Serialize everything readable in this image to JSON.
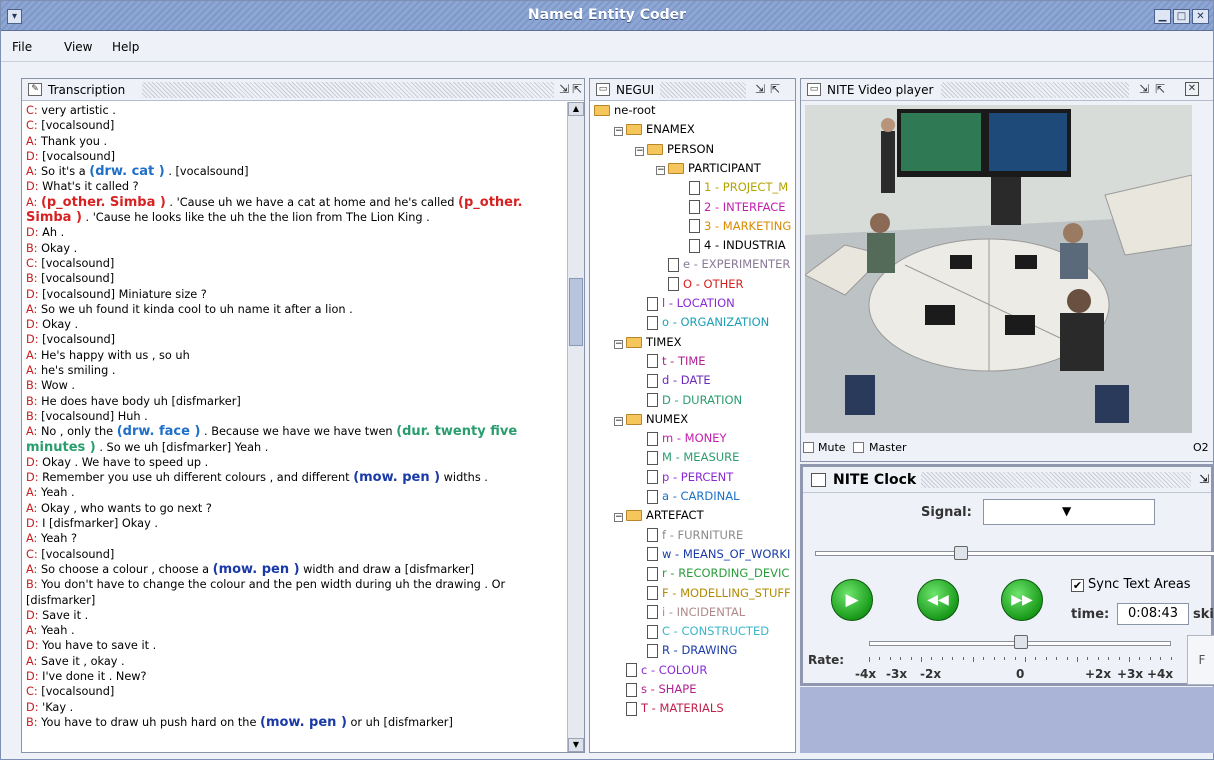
{
  "window": {
    "title": "Named Entity Coder"
  },
  "menu": [
    "File",
    "View",
    "Help"
  ],
  "transcription": {
    "title": "Transcription",
    "lines": [
      {
        "parts": [
          {
            "t": "C: ",
            "c": "#c41e1e"
          },
          {
            "t": "very artistic .",
            "c": "#000"
          }
        ]
      },
      {
        "parts": [
          {
            "t": "C: ",
            "c": "#c41e1e"
          },
          {
            "t": "[vocalsound]",
            "c": "#000"
          }
        ]
      },
      {
        "parts": [
          {
            "t": "A: ",
            "c": "#c41e1e"
          },
          {
            "t": "Thank you .",
            "c": "#000"
          }
        ]
      },
      {
        "parts": [
          {
            "t": "D: ",
            "c": "#c41e1e"
          },
          {
            "t": "[vocalsound]",
            "c": "#000"
          }
        ]
      },
      {
        "parts": [
          {
            "t": "A: ",
            "c": "#c41e1e"
          },
          {
            "t": "So it's a ",
            "c": "#000"
          },
          {
            "t": "(drw. cat )",
            "c": "#1f6fc7",
            "tag": true
          },
          {
            "t": " . [vocalsound]",
            "c": "#000"
          }
        ]
      },
      {
        "parts": [
          {
            "t": "D: ",
            "c": "#c41e1e"
          },
          {
            "t": "What's it called ?",
            "c": "#000"
          }
        ]
      },
      {
        "parts": [
          {
            "t": "A: ",
            "c": "#c41e1e"
          },
          {
            "t": "(p_other. Simba )",
            "c": "#d62222",
            "tag": true
          },
          {
            "t": " . 'Cause uh we have a cat at home and he's called ",
            "c": "#000"
          },
          {
            "t": "(p_other.",
            "c": "#d62222",
            "tag": true
          }
        ]
      },
      {
        "parts": [
          {
            "t": "Simba )",
            "c": "#d62222",
            "tag": true
          },
          {
            "t": " . 'Cause he looks like the uh the the lion from The Lion King .",
            "c": "#000"
          }
        ]
      },
      {
        "parts": [
          {
            "t": "D: ",
            "c": "#c41e1e"
          },
          {
            "t": "Ah .",
            "c": "#000"
          }
        ]
      },
      {
        "parts": [
          {
            "t": "B: ",
            "c": "#c41e1e"
          },
          {
            "t": "Okay .",
            "c": "#000"
          }
        ]
      },
      {
        "parts": [
          {
            "t": "C: ",
            "c": "#c41e1e"
          },
          {
            "t": "[vocalsound]",
            "c": "#000"
          }
        ]
      },
      {
        "parts": [
          {
            "t": "B: ",
            "c": "#c41e1e"
          },
          {
            "t": "[vocalsound]",
            "c": "#000"
          }
        ]
      },
      {
        "parts": [
          {
            "t": "D: ",
            "c": "#c41e1e"
          },
          {
            "t": "[vocalsound] Miniature size ?",
            "c": "#000"
          }
        ]
      },
      {
        "parts": [
          {
            "t": "A: ",
            "c": "#c41e1e"
          },
          {
            "t": "So we uh found it kinda cool to uh name it after a lion .",
            "c": "#000"
          }
        ]
      },
      {
        "parts": [
          {
            "t": "D: ",
            "c": "#c41e1e"
          },
          {
            "t": "Okay .",
            "c": "#000"
          }
        ]
      },
      {
        "parts": [
          {
            "t": "D: ",
            "c": "#c41e1e"
          },
          {
            "t": "[vocalsound]",
            "c": "#000"
          }
        ]
      },
      {
        "parts": [
          {
            "t": "A: ",
            "c": "#c41e1e"
          },
          {
            "t": "He's happy with us , so uh",
            "c": "#000"
          }
        ]
      },
      {
        "parts": [
          {
            "t": "A: ",
            "c": "#c41e1e"
          },
          {
            "t": "he's smiling .",
            "c": "#000"
          }
        ]
      },
      {
        "parts": [
          {
            "t": "B: ",
            "c": "#c41e1e"
          },
          {
            "t": "Wow .",
            "c": "#000"
          }
        ]
      },
      {
        "parts": [
          {
            "t": "B: ",
            "c": "#c41e1e"
          },
          {
            "t": "He does have body uh [disfmarker]",
            "c": "#000"
          }
        ]
      },
      {
        "parts": [
          {
            "t": "B: ",
            "c": "#c41e1e"
          },
          {
            "t": "[vocalsound] Huh .",
            "c": "#000"
          }
        ]
      },
      {
        "parts": [
          {
            "t": "A: ",
            "c": "#c41e1e"
          },
          {
            "t": "No , only the ",
            "c": "#000"
          },
          {
            "t": "(drw. face )",
            "c": "#1f6fc7",
            "tag": true
          },
          {
            "t": " . Because we have we have twen ",
            "c": "#000"
          },
          {
            "t": "(dur. twenty five",
            "c": "#2a9d6f",
            "tag": true
          }
        ]
      },
      {
        "parts": [
          {
            "t": "minutes )",
            "c": "#2a9d6f",
            "tag": true
          },
          {
            "t": " . So we uh [disfmarker] Yeah .",
            "c": "#000"
          }
        ]
      },
      {
        "parts": [
          {
            "t": "D: ",
            "c": "#c41e1e"
          },
          {
            "t": "Okay . We have to speed up .",
            "c": "#000"
          }
        ]
      },
      {
        "parts": [
          {
            "t": "D: ",
            "c": "#c41e1e"
          },
          {
            "t": "Remember you use uh different colours , and different ",
            "c": "#000"
          },
          {
            "t": "(mow. pen )",
            "c": "#1a3aa8",
            "tag": true
          },
          {
            "t": " widths .",
            "c": "#000"
          }
        ]
      },
      {
        "parts": [
          {
            "t": "A: ",
            "c": "#c41e1e"
          },
          {
            "t": "Yeah .",
            "c": "#000"
          }
        ]
      },
      {
        "parts": [
          {
            "t": "A: ",
            "c": "#c41e1e"
          },
          {
            "t": "Okay , who wants to go next ?",
            "c": "#000"
          }
        ]
      },
      {
        "parts": [
          {
            "t": "D: ",
            "c": "#c41e1e"
          },
          {
            "t": "I [disfmarker] Okay .",
            "c": "#000"
          }
        ]
      },
      {
        "parts": [
          {
            "t": "A: ",
            "c": "#c41e1e"
          },
          {
            "t": "Yeah ?",
            "c": "#000"
          }
        ]
      },
      {
        "parts": [
          {
            "t": "C: ",
            "c": "#c41e1e"
          },
          {
            "t": "[vocalsound]",
            "c": "#000"
          }
        ]
      },
      {
        "parts": [
          {
            "t": "A: ",
            "c": "#c41e1e"
          },
          {
            "t": "So choose a colour , choose a ",
            "c": "#000"
          },
          {
            "t": "(mow. pen )",
            "c": "#1a3aa8",
            "tag": true
          },
          {
            "t": " width and draw a [disfmarker]",
            "c": "#000"
          }
        ]
      },
      {
        "parts": [
          {
            "t": "B: ",
            "c": "#c41e1e"
          },
          {
            "t": "You don't have to change the colour and the pen width during uh the drawing . Or",
            "c": "#000"
          }
        ]
      },
      {
        "parts": [
          {
            "t": "[disfmarker]",
            "c": "#000"
          }
        ]
      },
      {
        "parts": [
          {
            "t": "D: ",
            "c": "#c41e1e"
          },
          {
            "t": "Save it .",
            "c": "#000"
          }
        ]
      },
      {
        "parts": [
          {
            "t": "A: ",
            "c": "#c41e1e"
          },
          {
            "t": "Yeah .",
            "c": "#000"
          }
        ]
      },
      {
        "parts": [
          {
            "t": "D: ",
            "c": "#c41e1e"
          },
          {
            "t": "You have to save it .",
            "c": "#000"
          }
        ]
      },
      {
        "parts": [
          {
            "t": "A: ",
            "c": "#c41e1e"
          },
          {
            "t": "Save it , okay .",
            "c": "#000"
          }
        ]
      },
      {
        "parts": [
          {
            "t": "D: ",
            "c": "#c41e1e"
          },
          {
            "t": "I've done it . New?",
            "c": "#000"
          }
        ]
      },
      {
        "parts": [
          {
            "t": "C: ",
            "c": "#c41e1e"
          },
          {
            "t": "[vocalsound]",
            "c": "#000"
          }
        ]
      },
      {
        "parts": [
          {
            "t": "D: ",
            "c": "#c41e1e"
          },
          {
            "t": "'Kay .",
            "c": "#000"
          }
        ]
      },
      {
        "parts": [
          {
            "t": "B: ",
            "c": "#c41e1e"
          },
          {
            "t": "You have to draw uh push hard on the ",
            "c": "#000"
          },
          {
            "t": "(mow. pen )",
            "c": "#1a3aa8",
            "tag": true
          },
          {
            "t": " or uh [disfmarker]",
            "c": "#000"
          }
        ]
      }
    ]
  },
  "negui": {
    "title": "NEGUI",
    "nodes": [
      {
        "label": "ne-root",
        "lvl": 0,
        "icon": "folder",
        "color": "#000",
        "toggle": false
      },
      {
        "label": "ENAMEX",
        "lvl": 1,
        "icon": "folder",
        "color": "#000",
        "toggle": true
      },
      {
        "label": "PERSON",
        "lvl": 2,
        "icon": "folder",
        "color": "#000",
        "toggle": true
      },
      {
        "label": "PARTICIPANT",
        "lvl": 3,
        "icon": "folder",
        "color": "#000",
        "toggle": true
      },
      {
        "label": "1 - PROJECT_M",
        "lvl": 4,
        "icon": "doc",
        "color": "#b3a300",
        "toggle": false
      },
      {
        "label": "2 - INTERFACE",
        "lvl": 4,
        "icon": "doc",
        "color": "#c21eb0",
        "toggle": false
      },
      {
        "label": "3 - MARKETING",
        "lvl": 4,
        "icon": "doc",
        "color": "#d98a00",
        "toggle": false
      },
      {
        "label": "4 - INDUSTRIA",
        "lvl": 4,
        "icon": "doc",
        "color": "#000",
        "toggle": false
      },
      {
        "label": "e - EXPERIMENTER",
        "lvl": 3,
        "icon": "doc",
        "color": "#8a7a96",
        "toggle": false
      },
      {
        "label": "O - OTHER",
        "lvl": 3,
        "icon": "doc",
        "color": "#d62222",
        "toggle": false
      },
      {
        "label": "l - LOCATION",
        "lvl": 2,
        "icon": "doc",
        "color": "#8a2bd6",
        "toggle": false
      },
      {
        "label": "o - ORGANIZATION",
        "lvl": 2,
        "icon": "doc",
        "color": "#1a9fb5",
        "toggle": false
      },
      {
        "label": "TIMEX",
        "lvl": 1,
        "icon": "folder",
        "color": "#000",
        "toggle": true
      },
      {
        "label": "t - TIME",
        "lvl": 2,
        "icon": "doc",
        "color": "#b0208f",
        "toggle": false
      },
      {
        "label": "d - DATE",
        "lvl": 2,
        "icon": "doc",
        "color": "#6a2ab8",
        "toggle": false
      },
      {
        "label": "D - DURATION",
        "lvl": 2,
        "icon": "doc",
        "color": "#2a9d6f",
        "toggle": false
      },
      {
        "label": "NUMEX",
        "lvl": 1,
        "icon": "folder",
        "color": "#000",
        "toggle": true
      },
      {
        "label": "m - MONEY",
        "lvl": 2,
        "icon": "doc",
        "color": "#c21eb0",
        "toggle": false
      },
      {
        "label": "M - MEASURE",
        "lvl": 2,
        "icon": "doc",
        "color": "#2a9d6f",
        "toggle": false
      },
      {
        "label": "p - PERCENT",
        "lvl": 2,
        "icon": "doc",
        "color": "#8a2bd6",
        "toggle": false
      },
      {
        "label": "a - CARDINAL",
        "lvl": 2,
        "icon": "doc",
        "color": "#1a6fc7",
        "toggle": false
      },
      {
        "label": "ARTEFACT",
        "lvl": 1,
        "icon": "folder",
        "color": "#000",
        "toggle": true
      },
      {
        "label": "f - FURNITURE",
        "lvl": 2,
        "icon": "doc",
        "color": "#8a8a8a",
        "toggle": false
      },
      {
        "label": "w - MEANS_OF_WORKI",
        "lvl": 2,
        "icon": "doc",
        "color": "#1a3aa8",
        "toggle": false
      },
      {
        "label": "r - RECORDING_DEVIC",
        "lvl": 2,
        "icon": "doc",
        "color": "#2a9d3a",
        "toggle": false
      },
      {
        "label": "F - MODELLING_STUFF",
        "lvl": 2,
        "icon": "doc",
        "color": "#b38a00",
        "toggle": false
      },
      {
        "label": "i - INCIDENTAL",
        "lvl": 2,
        "icon": "doc",
        "color": "#b08a8a",
        "toggle": false
      },
      {
        "label": "C - CONSTRUCTED",
        "lvl": 2,
        "icon": "doc",
        "color": "#3ab5c9",
        "toggle": false
      },
      {
        "label": "R - DRAWING",
        "lvl": 2,
        "icon": "doc",
        "color": "#1a3aa8",
        "toggle": false
      },
      {
        "label": "c - COLOUR",
        "lvl": 1,
        "icon": "doc",
        "color": "#8a2bd6",
        "toggle": false
      },
      {
        "label": "s - SHAPE",
        "lvl": 1,
        "icon": "doc",
        "color": "#b0208f",
        "toggle": false
      },
      {
        "label": "T - MATERIALS",
        "lvl": 1,
        "icon": "doc",
        "color": "#c21e4a",
        "toggle": false
      }
    ]
  },
  "video": {
    "title": "NITE Video player",
    "mute_label": "Mute",
    "master_label": "Master",
    "status_fragment": "O2"
  },
  "clock": {
    "title": "NITE Clock",
    "signal_label": "Signal:",
    "sync_label": "Sync Text Areas",
    "sync_checked": true,
    "time_label": "time:",
    "time_value": "0:08:43",
    "skip_label": "skip",
    "rate_label": "Rate:",
    "rate_ticks": [
      "-4x",
      "-3x",
      "-2x",
      "0",
      "+2x",
      "+3x",
      "+4x"
    ],
    "rate_knob_value": "0",
    "button_fragment": "F"
  },
  "icons": [
    "panel-doc-icon",
    "play-icon",
    "rewind-icon",
    "fast-forward-icon",
    "folder-icon",
    "document-icon"
  ]
}
